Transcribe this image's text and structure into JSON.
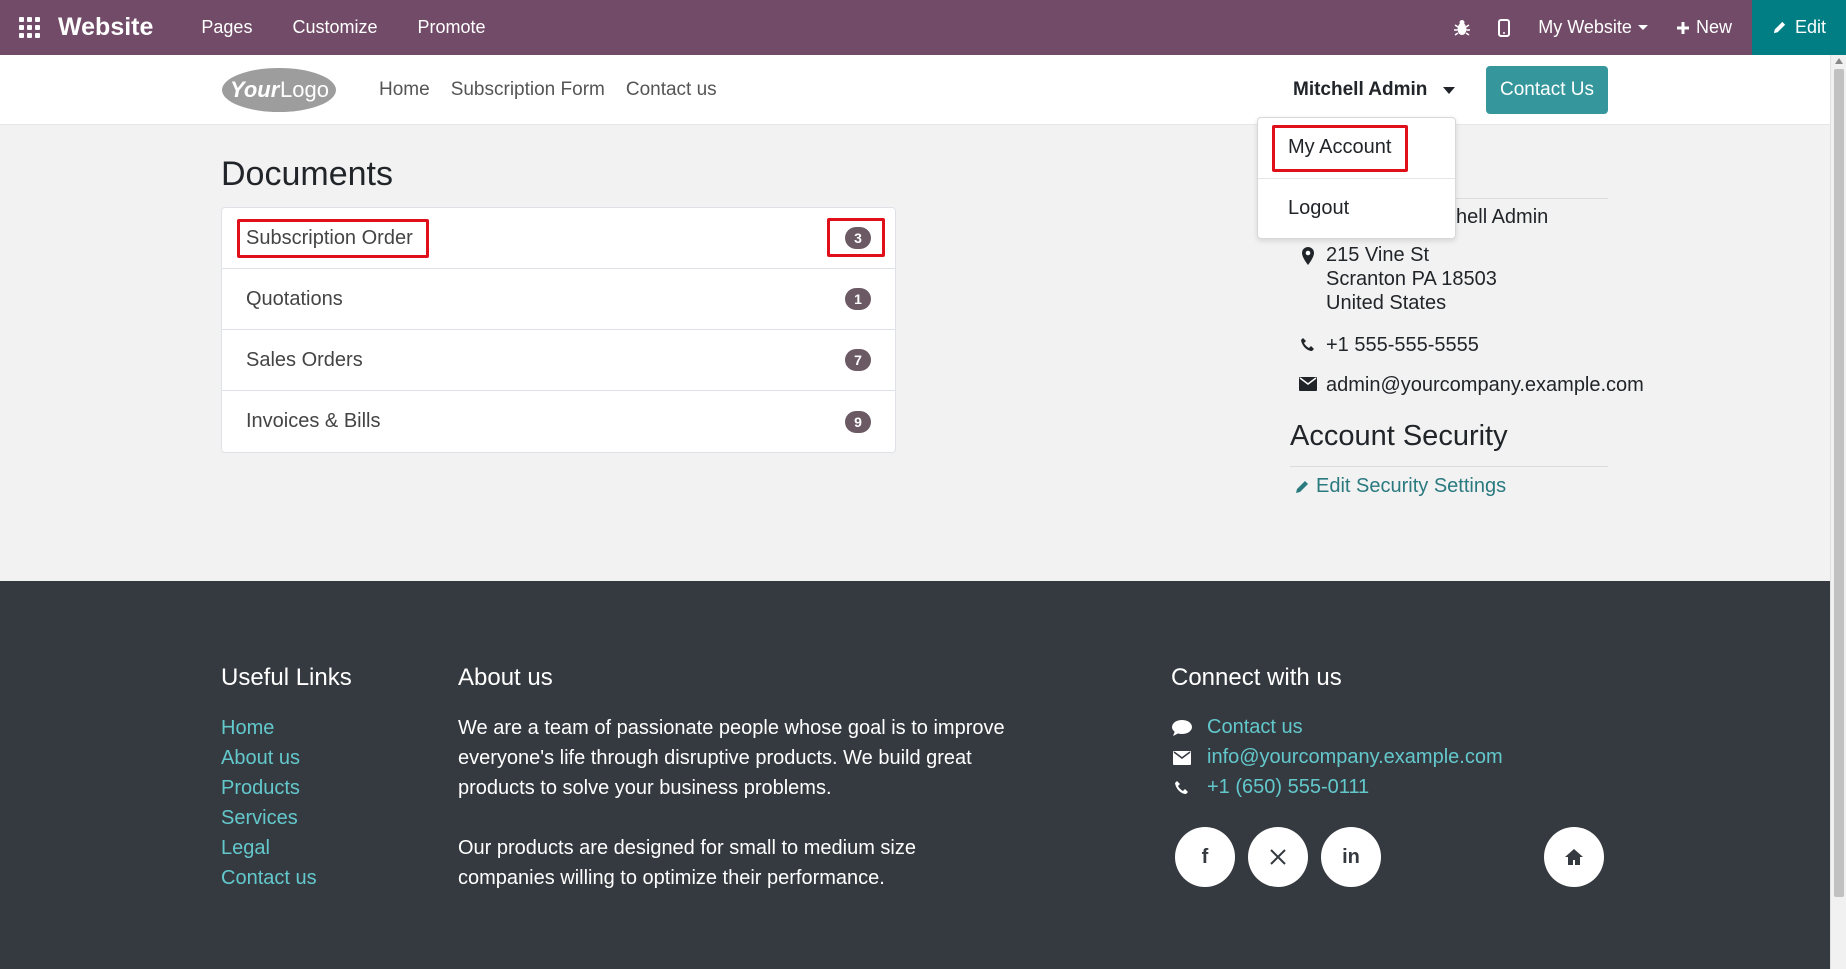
{
  "admin_bar": {
    "brand": "Website",
    "menu": [
      "Pages",
      "Customize",
      "Promote"
    ],
    "website_selector": "My Website",
    "new_label": "New",
    "edit_label": "Edit"
  },
  "site_header": {
    "logo_text": "YourLogo",
    "nav": [
      "Home",
      "Subscription Form",
      "Contact us"
    ],
    "user_name": "Mitchell Admin",
    "contact_button": "Contact Us"
  },
  "user_dropdown": {
    "items": [
      "My Account",
      "Logout"
    ]
  },
  "documents": {
    "title": "Documents",
    "items": [
      {
        "label": "Subscription Order",
        "count": "3"
      },
      {
        "label": "Quotations",
        "count": "1"
      },
      {
        "label": "Sales Orders",
        "count": "7"
      },
      {
        "label": "Invoices & Bills",
        "count": "9"
      }
    ]
  },
  "account_info": {
    "name_partial": "chell Admin",
    "address": [
      "215 Vine St",
      "Scranton PA 18503",
      "United States"
    ],
    "phone": "+1 555-555-5555",
    "email": "admin@yourcompany.example.com"
  },
  "account_security": {
    "title": "Account Security",
    "link": "Edit Security Settings"
  },
  "footer": {
    "useful_links_title": "Useful Links",
    "useful_links": [
      "Home",
      "About us",
      "Products",
      "Services",
      "Legal",
      "Contact us"
    ],
    "about_title": "About us",
    "about_p1": [
      "We are a team of passionate people whose goal is to improve",
      "everyone's life through disruptive products. We build great",
      "products to solve your business problems."
    ],
    "about_p2": [
      "Our products are designed for small to medium size",
      "companies willing to optimize their performance."
    ],
    "connect_title": "Connect with us",
    "connect": {
      "contact": "Contact us",
      "email": "info@yourcompany.example.com",
      "phone": "+1 (650) 555-0111"
    },
    "social": {
      "facebook": "f",
      "linkedin": "in"
    }
  },
  "colors": {
    "admin_bar": "#714b67",
    "edit_button": "#017e84",
    "primary_button": "#35979c",
    "footer_bg": "#353a40",
    "footer_link": "#63c8cc",
    "highlight": "#e0101b"
  }
}
